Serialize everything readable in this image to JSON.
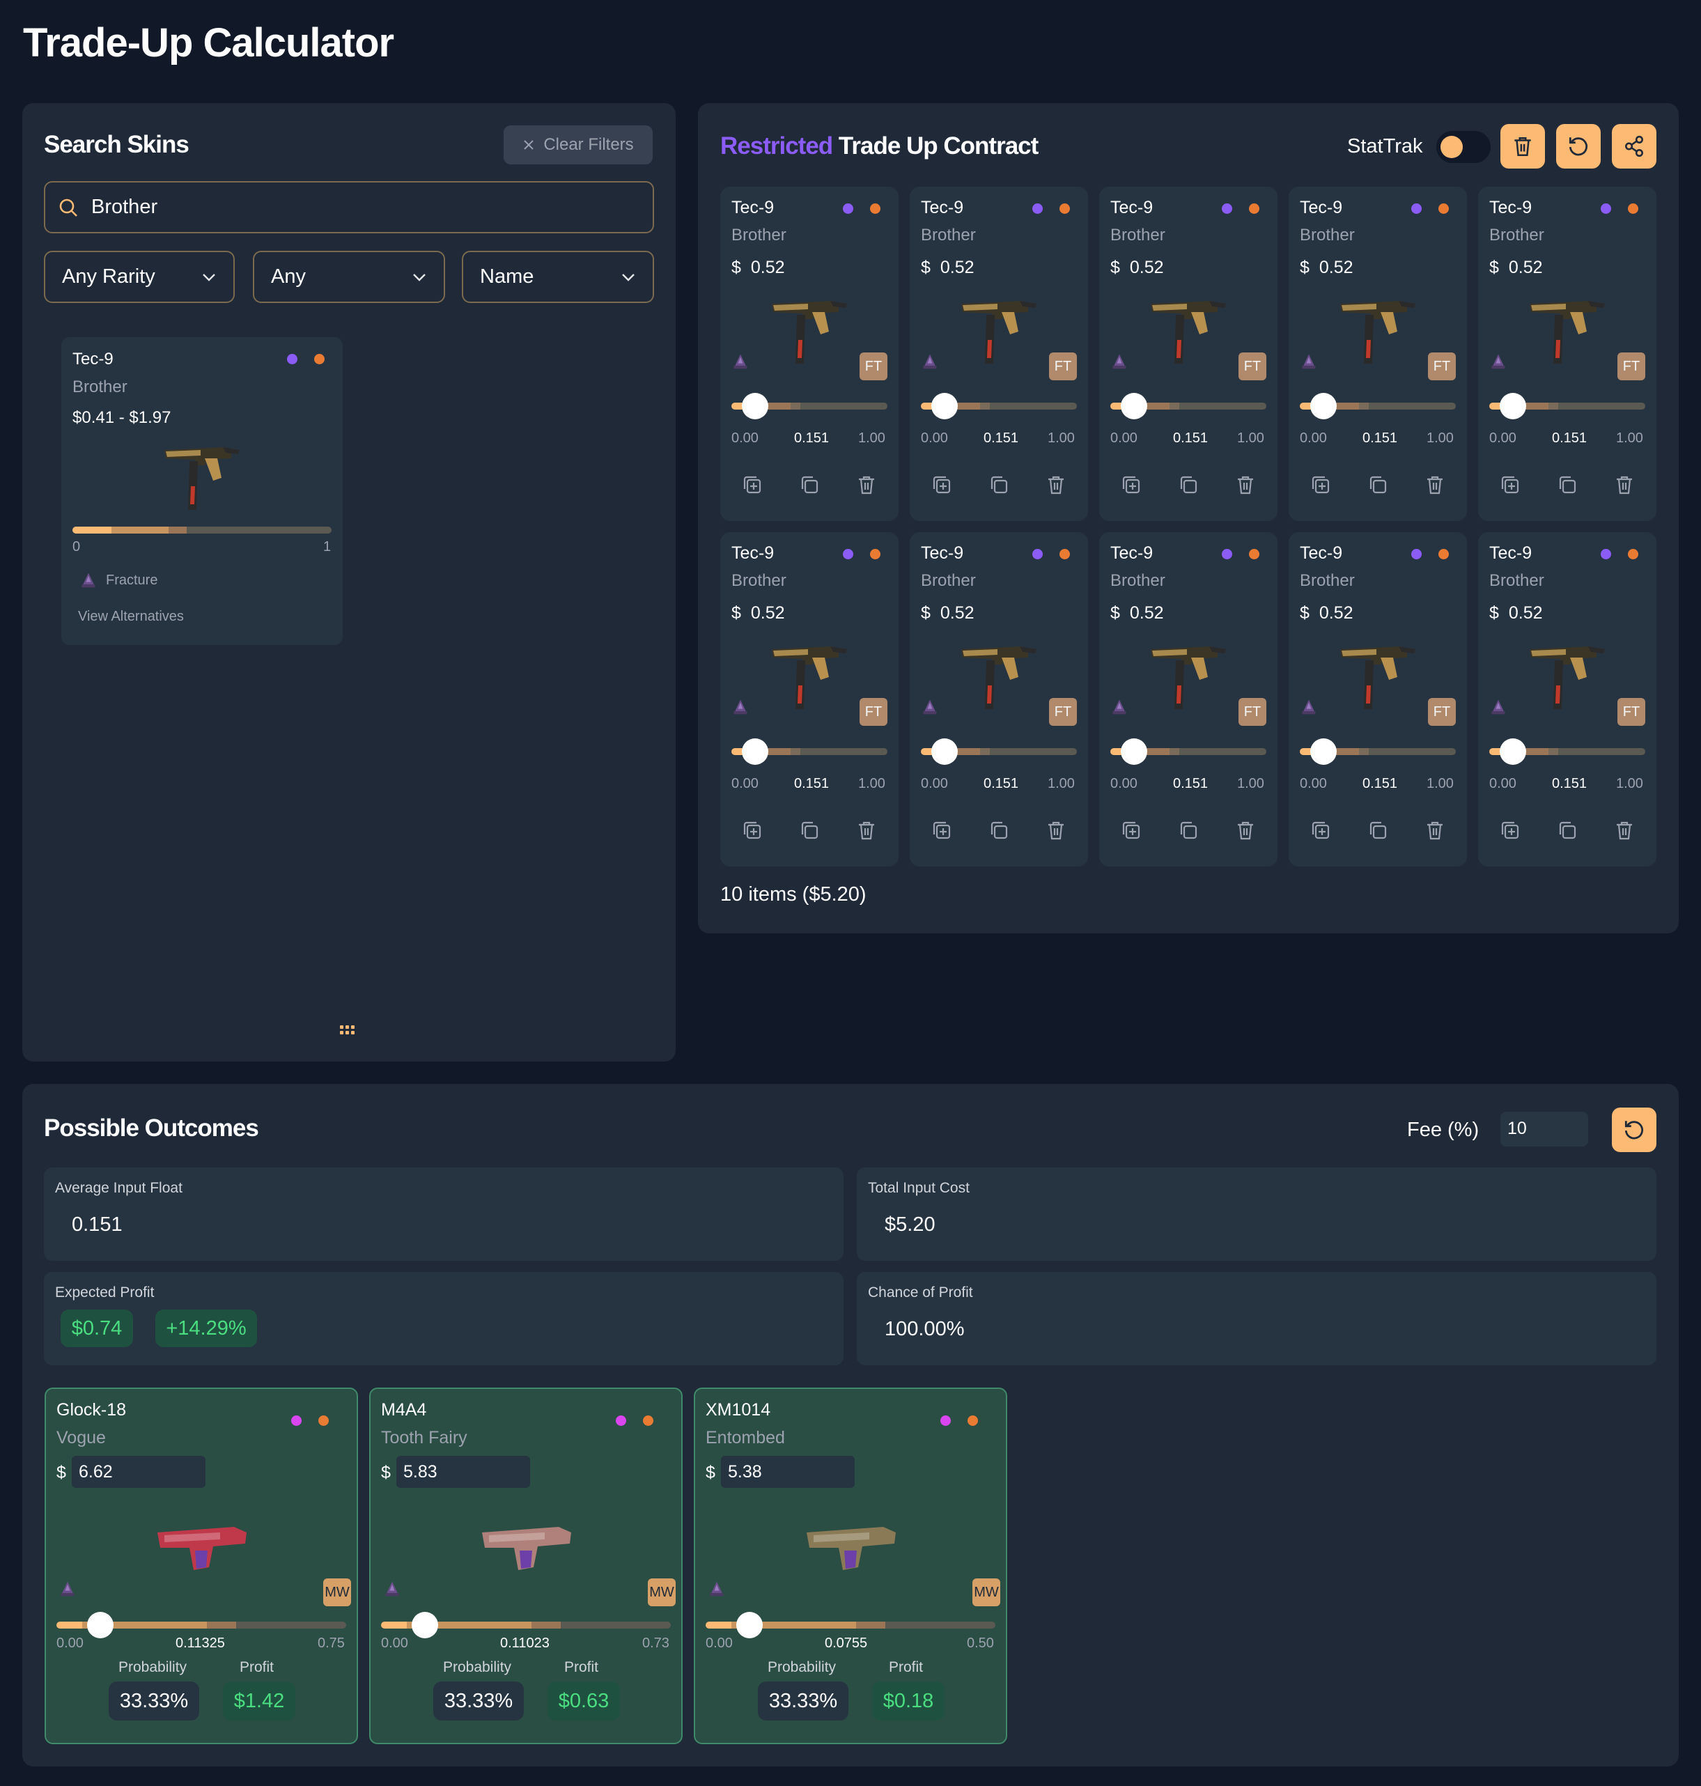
{
  "page": {
    "title": "Trade-Up Calculator"
  },
  "search": {
    "title": "Search Skins",
    "clear_label": "Clear Filters",
    "query": "Brother",
    "filters": {
      "rarity": "Any Rarity",
      "wear": "Any",
      "sort": "Name"
    },
    "result": {
      "weapon": "Tec-9",
      "skin": "Brother",
      "price_range": "$0.41 - $1.97",
      "float_min": "0",
      "float_max": "1",
      "collection": "Fracture",
      "alternatives_label": "View Alternatives",
      "rarity_color": "#8b5cf6",
      "grade_color": "#ea7b33"
    }
  },
  "contract": {
    "rarity_label": "Restricted",
    "title_rest": "Trade Up Contract",
    "stattrak_label": "StatTrak",
    "stattrak_enabled": false,
    "slots": [
      {
        "weapon": "Tec-9",
        "skin": "Brother",
        "currency": "$",
        "price": "0.52",
        "wear": "FT",
        "float": "0.151",
        "float_min": "0.00",
        "float_max": "1.00"
      },
      {
        "weapon": "Tec-9",
        "skin": "Brother",
        "currency": "$",
        "price": "0.52",
        "wear": "FT",
        "float": "0.151",
        "float_min": "0.00",
        "float_max": "1.00"
      },
      {
        "weapon": "Tec-9",
        "skin": "Brother",
        "currency": "$",
        "price": "0.52",
        "wear": "FT",
        "float": "0.151",
        "float_min": "0.00",
        "float_max": "1.00"
      },
      {
        "weapon": "Tec-9",
        "skin": "Brother",
        "currency": "$",
        "price": "0.52",
        "wear": "FT",
        "float": "0.151",
        "float_min": "0.00",
        "float_max": "1.00"
      },
      {
        "weapon": "Tec-9",
        "skin": "Brother",
        "currency": "$",
        "price": "0.52",
        "wear": "FT",
        "float": "0.151",
        "float_min": "0.00",
        "float_max": "1.00"
      },
      {
        "weapon": "Tec-9",
        "skin": "Brother",
        "currency": "$",
        "price": "0.52",
        "wear": "FT",
        "float": "0.151",
        "float_min": "0.00",
        "float_max": "1.00"
      },
      {
        "weapon": "Tec-9",
        "skin": "Brother",
        "currency": "$",
        "price": "0.52",
        "wear": "FT",
        "float": "0.151",
        "float_min": "0.00",
        "float_max": "1.00"
      },
      {
        "weapon": "Tec-9",
        "skin": "Brother",
        "currency": "$",
        "price": "0.52",
        "wear": "FT",
        "float": "0.151",
        "float_min": "0.00",
        "float_max": "1.00"
      },
      {
        "weapon": "Tec-9",
        "skin": "Brother",
        "currency": "$",
        "price": "0.52",
        "wear": "FT",
        "float": "0.151",
        "float_min": "0.00",
        "float_max": "1.00"
      },
      {
        "weapon": "Tec-9",
        "skin": "Brother",
        "currency": "$",
        "price": "0.52",
        "wear": "FT",
        "float": "0.151",
        "float_min": "0.00",
        "float_max": "1.00"
      }
    ],
    "summary": "10 items ($5.20)"
  },
  "outcomes": {
    "title": "Possible Outcomes",
    "fee_label": "Fee (%)",
    "fee_value": "10",
    "stats": {
      "avg_float_label": "Average Input Float",
      "avg_float": "0.151",
      "total_cost_label": "Total Input Cost",
      "total_cost": "$5.20",
      "expected_profit_label": "Expected Profit",
      "expected_profit": "$0.74",
      "expected_profit_pct": "+14.29%",
      "chance_label": "Chance of Profit",
      "chance": "100.00%"
    },
    "probability_label": "Probability",
    "profit_label": "Profit",
    "items": [
      {
        "weapon": "Glock-18",
        "skin": "Vogue",
        "currency": "$",
        "price": "6.62",
        "wear": "MW",
        "float": "0.11325",
        "float_min": "0.00",
        "float_max": "0.75",
        "probability": "33.33%",
        "profit": "$1.42",
        "thumb": "#c0394b"
      },
      {
        "weapon": "M4A4",
        "skin": "Tooth Fairy",
        "currency": "$",
        "price": "5.83",
        "wear": "MW",
        "float": "0.11023",
        "float_min": "0.00",
        "float_max": "0.73",
        "probability": "33.33%",
        "profit": "$0.63",
        "thumb": "#b0807a"
      },
      {
        "weapon": "XM1014",
        "skin": "Entombed",
        "currency": "$",
        "price": "5.38",
        "wear": "MW",
        "float": "0.0755",
        "float_min": "0.00",
        "float_max": "0.50",
        "probability": "33.33%",
        "profit": "$0.18",
        "thumb": "#8a7a55"
      }
    ],
    "covert_color": "#d946ef",
    "grade_color": "#ea7b33"
  }
}
